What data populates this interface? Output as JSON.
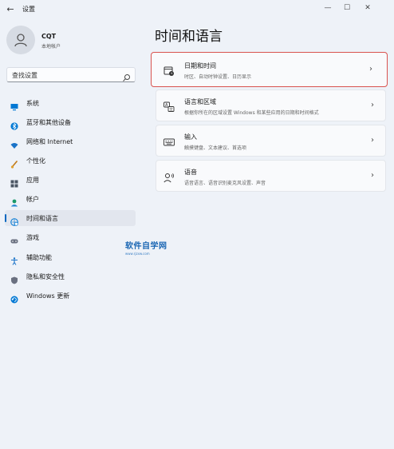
{
  "window": {
    "title": "设置",
    "back_icon": "←",
    "minimize": "—",
    "maximize": "☐",
    "close": "✕"
  },
  "user": {
    "name": "CQT",
    "account_type": "本地帐户"
  },
  "search": {
    "placeholder": "查找设置"
  },
  "sidebar": {
    "items": [
      {
        "label": "系统",
        "icon": "system-icon",
        "color": "#0078d4"
      },
      {
        "label": "蓝牙和其他设备",
        "icon": "bluetooth-icon",
        "color": "#0078d4"
      },
      {
        "label": "网络和 Internet",
        "icon": "wifi-icon",
        "color": "#1a73c8"
      },
      {
        "label": "个性化",
        "icon": "brush-icon",
        "color": "#c07a1a"
      },
      {
        "label": "应用",
        "icon": "apps-icon",
        "color": "#4a5563"
      },
      {
        "label": "帐户",
        "icon": "account-icon",
        "color": "#1a9a6a"
      },
      {
        "label": "时间和语言",
        "icon": "globe-clock-icon",
        "color": "#0078d4",
        "selected": true
      },
      {
        "label": "游戏",
        "icon": "gamepad-icon",
        "color": "#6a7080"
      },
      {
        "label": "辅助功能",
        "icon": "accessibility-icon",
        "color": "#1a73c8"
      },
      {
        "label": "隐私和安全性",
        "icon": "shield-icon",
        "color": "#6a7080"
      },
      {
        "label": "Windows 更新",
        "icon": "update-icon",
        "color": "#0078d4"
      }
    ]
  },
  "main": {
    "title": "时间和语言",
    "cards": [
      {
        "title": "日期和时间",
        "subtitle": "时区、自动时钟设置、日历显示",
        "icon": "calendar-clock-icon",
        "highlighted": true
      },
      {
        "title": "语言和区域",
        "subtitle": "根据你所在的区域设置 Windows 和某些应用的日期和时间格式",
        "icon": "language-icon"
      },
      {
        "title": "输入",
        "subtitle": "触摸键盘、文本建议、首选项",
        "icon": "keyboard-icon"
      },
      {
        "title": "语音",
        "subtitle": "语音语言、语音识别麦克风设置、声音",
        "icon": "speech-icon"
      }
    ],
    "chevron": "›"
  },
  "watermark": {
    "main": "软件自学网",
    "sub": "www.rjzxw.com"
  },
  "colors": {
    "accent": "#0067c0",
    "highlight_border": "#d9534f",
    "background": "#eef2f8"
  }
}
